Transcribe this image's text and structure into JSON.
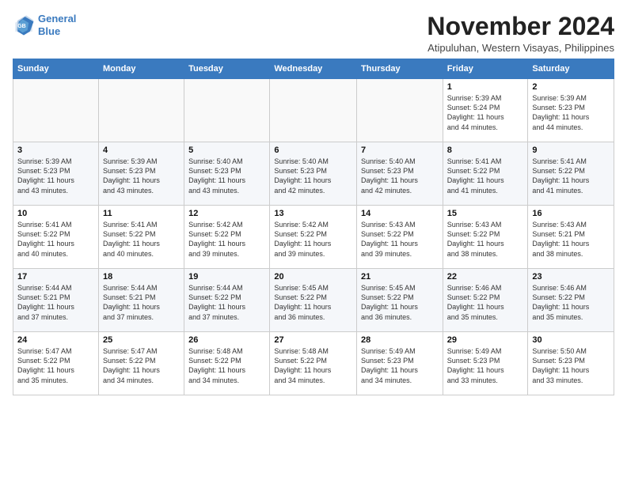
{
  "logo": {
    "line1": "General",
    "line2": "Blue"
  },
  "title": "November 2024",
  "location": "Atipuluhan, Western Visayas, Philippines",
  "days_of_week": [
    "Sunday",
    "Monday",
    "Tuesday",
    "Wednesday",
    "Thursday",
    "Friday",
    "Saturday"
  ],
  "weeks": [
    [
      {
        "day": "",
        "detail": ""
      },
      {
        "day": "",
        "detail": ""
      },
      {
        "day": "",
        "detail": ""
      },
      {
        "day": "",
        "detail": ""
      },
      {
        "day": "",
        "detail": ""
      },
      {
        "day": "1",
        "detail": "Sunrise: 5:39 AM\nSunset: 5:24 PM\nDaylight: 11 hours\nand 44 minutes."
      },
      {
        "day": "2",
        "detail": "Sunrise: 5:39 AM\nSunset: 5:23 PM\nDaylight: 11 hours\nand 44 minutes."
      }
    ],
    [
      {
        "day": "3",
        "detail": "Sunrise: 5:39 AM\nSunset: 5:23 PM\nDaylight: 11 hours\nand 43 minutes."
      },
      {
        "day": "4",
        "detail": "Sunrise: 5:39 AM\nSunset: 5:23 PM\nDaylight: 11 hours\nand 43 minutes."
      },
      {
        "day": "5",
        "detail": "Sunrise: 5:40 AM\nSunset: 5:23 PM\nDaylight: 11 hours\nand 43 minutes."
      },
      {
        "day": "6",
        "detail": "Sunrise: 5:40 AM\nSunset: 5:23 PM\nDaylight: 11 hours\nand 42 minutes."
      },
      {
        "day": "7",
        "detail": "Sunrise: 5:40 AM\nSunset: 5:23 PM\nDaylight: 11 hours\nand 42 minutes."
      },
      {
        "day": "8",
        "detail": "Sunrise: 5:41 AM\nSunset: 5:22 PM\nDaylight: 11 hours\nand 41 minutes."
      },
      {
        "day": "9",
        "detail": "Sunrise: 5:41 AM\nSunset: 5:22 PM\nDaylight: 11 hours\nand 41 minutes."
      }
    ],
    [
      {
        "day": "10",
        "detail": "Sunrise: 5:41 AM\nSunset: 5:22 PM\nDaylight: 11 hours\nand 40 minutes."
      },
      {
        "day": "11",
        "detail": "Sunrise: 5:41 AM\nSunset: 5:22 PM\nDaylight: 11 hours\nand 40 minutes."
      },
      {
        "day": "12",
        "detail": "Sunrise: 5:42 AM\nSunset: 5:22 PM\nDaylight: 11 hours\nand 39 minutes."
      },
      {
        "day": "13",
        "detail": "Sunrise: 5:42 AM\nSunset: 5:22 PM\nDaylight: 11 hours\nand 39 minutes."
      },
      {
        "day": "14",
        "detail": "Sunrise: 5:43 AM\nSunset: 5:22 PM\nDaylight: 11 hours\nand 39 minutes."
      },
      {
        "day": "15",
        "detail": "Sunrise: 5:43 AM\nSunset: 5:22 PM\nDaylight: 11 hours\nand 38 minutes."
      },
      {
        "day": "16",
        "detail": "Sunrise: 5:43 AM\nSunset: 5:21 PM\nDaylight: 11 hours\nand 38 minutes."
      }
    ],
    [
      {
        "day": "17",
        "detail": "Sunrise: 5:44 AM\nSunset: 5:21 PM\nDaylight: 11 hours\nand 37 minutes."
      },
      {
        "day": "18",
        "detail": "Sunrise: 5:44 AM\nSunset: 5:21 PM\nDaylight: 11 hours\nand 37 minutes."
      },
      {
        "day": "19",
        "detail": "Sunrise: 5:44 AM\nSunset: 5:22 PM\nDaylight: 11 hours\nand 37 minutes."
      },
      {
        "day": "20",
        "detail": "Sunrise: 5:45 AM\nSunset: 5:22 PM\nDaylight: 11 hours\nand 36 minutes."
      },
      {
        "day": "21",
        "detail": "Sunrise: 5:45 AM\nSunset: 5:22 PM\nDaylight: 11 hours\nand 36 minutes."
      },
      {
        "day": "22",
        "detail": "Sunrise: 5:46 AM\nSunset: 5:22 PM\nDaylight: 11 hours\nand 35 minutes."
      },
      {
        "day": "23",
        "detail": "Sunrise: 5:46 AM\nSunset: 5:22 PM\nDaylight: 11 hours\nand 35 minutes."
      }
    ],
    [
      {
        "day": "24",
        "detail": "Sunrise: 5:47 AM\nSunset: 5:22 PM\nDaylight: 11 hours\nand 35 minutes."
      },
      {
        "day": "25",
        "detail": "Sunrise: 5:47 AM\nSunset: 5:22 PM\nDaylight: 11 hours\nand 34 minutes."
      },
      {
        "day": "26",
        "detail": "Sunrise: 5:48 AM\nSunset: 5:22 PM\nDaylight: 11 hours\nand 34 minutes."
      },
      {
        "day": "27",
        "detail": "Sunrise: 5:48 AM\nSunset: 5:22 PM\nDaylight: 11 hours\nand 34 minutes."
      },
      {
        "day": "28",
        "detail": "Sunrise: 5:49 AM\nSunset: 5:23 PM\nDaylight: 11 hours\nand 34 minutes."
      },
      {
        "day": "29",
        "detail": "Sunrise: 5:49 AM\nSunset: 5:23 PM\nDaylight: 11 hours\nand 33 minutes."
      },
      {
        "day": "30",
        "detail": "Sunrise: 5:50 AM\nSunset: 5:23 PM\nDaylight: 11 hours\nand 33 minutes."
      }
    ]
  ]
}
